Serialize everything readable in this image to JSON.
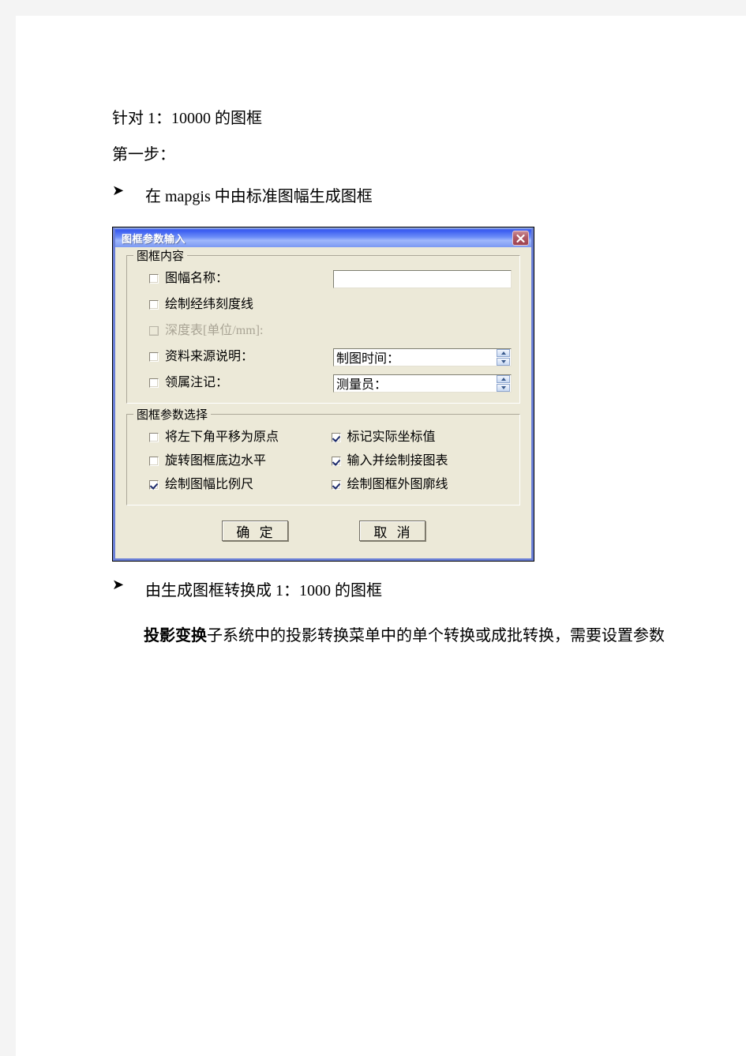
{
  "document": {
    "line1": "针对 1：10000 的图框",
    "line2": "第一步：",
    "bullet1": "在 mapgis 中由标准图幅生成图框",
    "bullet2": "由生成图框转换成 1：1000 的图框",
    "para_bold": "投影变换",
    "para_rest": "子系统中的投影转换菜单中的单个转换或成批转换，需要设置参数"
  },
  "dialog": {
    "title": "图框参数输入",
    "close_icon": "close-icon",
    "group_content": {
      "title": "图框内容",
      "rows": [
        {
          "label": "图幅名称：",
          "checked": false,
          "disabled": false,
          "field": "text",
          "value": ""
        },
        {
          "label": "绘制经纬刻度线",
          "checked": false,
          "disabled": false,
          "field": "none",
          "value": ""
        },
        {
          "label": "深度表[单位/mm]:",
          "checked": false,
          "disabled": true,
          "field": "none",
          "value": ""
        },
        {
          "label": "资料来源说明：",
          "checked": false,
          "disabled": false,
          "field": "spin",
          "value": "制图时间："
        },
        {
          "label": "领属注记：",
          "checked": false,
          "disabled": false,
          "field": "spin",
          "value": "测量员："
        }
      ]
    },
    "group_params": {
      "title": "图框参数选择",
      "rows": [
        {
          "left": {
            "label": "将左下角平移为原点",
            "checked": false
          },
          "right": {
            "label": "标记实际坐标值",
            "checked": true
          }
        },
        {
          "left": {
            "label": "旋转图框底边水平",
            "checked": false
          },
          "right": {
            "label": "输入并绘制接图表",
            "checked": true
          }
        },
        {
          "left": {
            "label": "绘制图幅比例尺",
            "checked": true
          },
          "right": {
            "label": "绘制图框外图廓线",
            "checked": true
          }
        }
      ]
    },
    "buttons": {
      "ok": "确 定",
      "cancel": "取 消"
    }
  },
  "colors": {
    "titlebar_blue": "#3a5cf0",
    "dialog_face": "#ece9d8",
    "close_red": "#9e4250",
    "check_blue": "#1b2a6b"
  }
}
